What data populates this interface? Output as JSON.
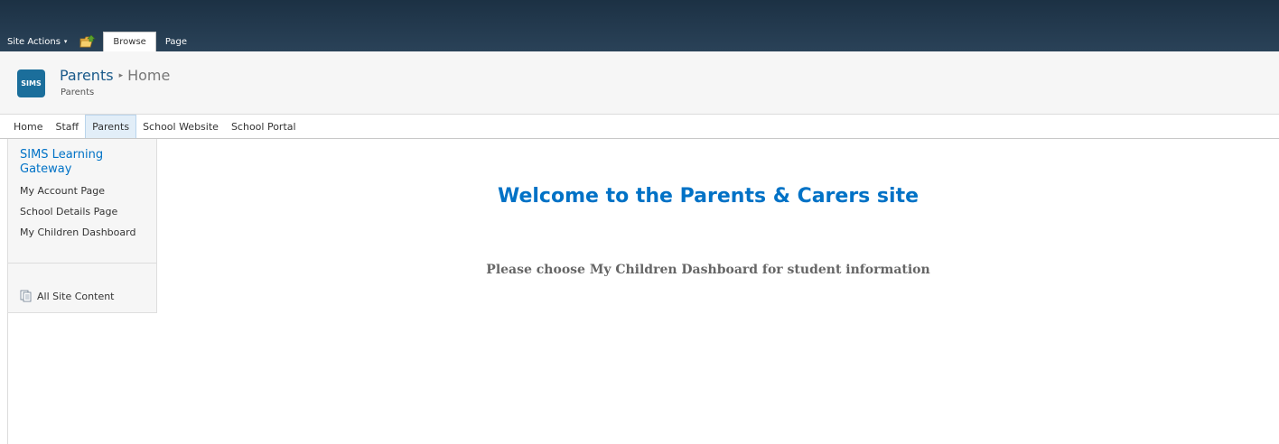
{
  "ribbon": {
    "site_actions_label": "Site Actions",
    "site_actions_caret": "▾",
    "tabs": [
      {
        "label": "Browse",
        "active": true
      },
      {
        "label": "Page",
        "active": false
      }
    ]
  },
  "title_area": {
    "logo_text": "SIMS",
    "breadcrumb_site": "Parents",
    "breadcrumb_separator": "▸",
    "breadcrumb_current": "Home",
    "subtitle": "Parents"
  },
  "topnav": {
    "items": [
      {
        "label": "Home",
        "selected": false
      },
      {
        "label": "Staff",
        "selected": false
      },
      {
        "label": "Parents",
        "selected": true
      },
      {
        "label": "School Website",
        "selected": false
      },
      {
        "label": "School Portal",
        "selected": false
      }
    ]
  },
  "leftnav": {
    "header": "SIMS Learning Gateway",
    "links": [
      "My Account Page",
      "School Details Page",
      "My Children Dashboard"
    ],
    "all_site_content": "All Site Content"
  },
  "main": {
    "welcome": "Welcome to the Parents & Carers site",
    "instruction": "Please choose My Children Dashboard for student information"
  },
  "colors": {
    "ribbon_bg": "#21374c",
    "link_blue": "#0072c6",
    "logo_bg": "#1b6e9b"
  }
}
